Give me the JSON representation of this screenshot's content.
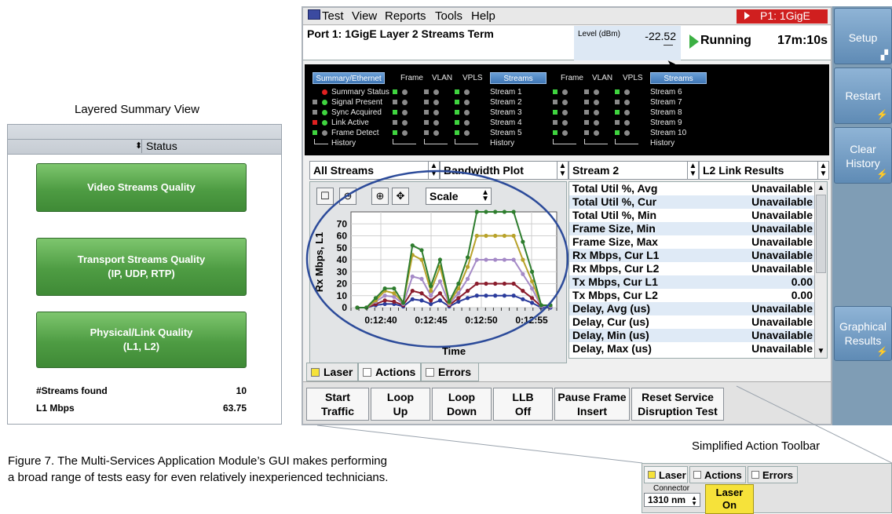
{
  "layered_summary": {
    "title": "Layered Summary View",
    "header_column": "Status",
    "buttons": [
      {
        "line1": "Video Streams Quality",
        "line2": ""
      },
      {
        "line1": "Transport Streams Quality",
        "line2": "(IP, UDP, RTP)"
      },
      {
        "line1": "Physical/Link Quality",
        "line2": "(L1, L2)"
      }
    ],
    "stats": [
      {
        "label": "#Streams found",
        "value": "10"
      },
      {
        "label": "L1 Mbps",
        "value": "63.75"
      }
    ],
    "colors": {
      "button_green": "#4e9c43"
    }
  },
  "menubar": {
    "items": [
      "Test",
      "View",
      "Reports",
      "Tools",
      "Help"
    ],
    "port_indicator": "P1: 1GigE",
    "indicator_color": "#d01f1f"
  },
  "status_bar": {
    "port_name": "Port 1: 1GigE Layer 2 Streams Term",
    "level_label": "Level (dBm)",
    "level_value": "-22.52",
    "state": "Running",
    "elapsed": "17m:10s"
  },
  "led_panel": {
    "summary_button": "Summary/Ethernet",
    "group1_headers": [
      "Frame",
      "VLAN",
      "VPLS"
    ],
    "group1_button": "Streams",
    "group2_headers": [
      "Frame",
      "VLAN",
      "VPLS"
    ],
    "group2_button": "Streams",
    "status_labels": [
      "Summary Status",
      "Signal Present",
      "Sync Acquired",
      "Link Active",
      "Frame Detect"
    ],
    "history_label": "History",
    "streams_a": [
      "Stream 1",
      "Stream 2",
      "Stream 3",
      "Stream 4",
      "Stream 5"
    ],
    "streams_b": [
      "Stream 6",
      "Stream 7",
      "Stream 8",
      "Stream 9",
      "Stream 10"
    ],
    "colors": {
      "green": "#3fd43f",
      "red": "#e02020",
      "grey": "#8a8a8a"
    }
  },
  "selectors": {
    "filter": "All Streams",
    "view": "Bandwidth Plot",
    "stream": "Stream 2",
    "results": "L2 Link Results"
  },
  "plot_toolbar": {
    "scale_label": "Scale"
  },
  "chart_data": {
    "type": "line",
    "title": "",
    "xlabel": "Time",
    "ylabel": "Rx Mbps, L1",
    "x_ticks": [
      "0:12:40",
      "0:12:45",
      "0:12:50",
      "0:12:55"
    ],
    "y_ticks": [
      0,
      10,
      20,
      30,
      40,
      50,
      60,
      70
    ],
    "ylim": [
      0,
      80
    ],
    "grid": true,
    "x": [
      0,
      1,
      2,
      3,
      4,
      5,
      6,
      7,
      8,
      9,
      10,
      11,
      12,
      13,
      14,
      15,
      16,
      17,
      18,
      19,
      20,
      21
    ],
    "series": [
      {
        "color": "#2e7d2e",
        "values": [
          0,
          0,
          8,
          16,
          16,
          4,
          52,
          48,
          18,
          40,
          5,
          20,
          42,
          80,
          80,
          80,
          80,
          80,
          55,
          30,
          2,
          2
        ]
      },
      {
        "color": "#b8a22a",
        "values": [
          0,
          0,
          6,
          14,
          12,
          4,
          44,
          40,
          14,
          34,
          4,
          16,
          34,
          60,
          60,
          60,
          60,
          60,
          40,
          22,
          2,
          2
        ]
      },
      {
        "color": "#a58ac7",
        "values": [
          0,
          0,
          5,
          10,
          9,
          3,
          26,
          24,
          10,
          22,
          3,
          12,
          24,
          40,
          40,
          40,
          40,
          40,
          28,
          16,
          1,
          1
        ]
      },
      {
        "color": "#8a1c2c",
        "values": [
          0,
          0,
          3,
          6,
          5,
          2,
          14,
          12,
          6,
          12,
          2,
          8,
          14,
          20,
          20,
          20,
          20,
          20,
          14,
          8,
          1,
          1
        ]
      },
      {
        "color": "#2a3b9c",
        "values": [
          0,
          0,
          2,
          3,
          3,
          1,
          7,
          6,
          3,
          6,
          1,
          5,
          8,
          10,
          10,
          10,
          10,
          10,
          7,
          4,
          0,
          0
        ]
      }
    ]
  },
  "results_table": [
    {
      "k": "Total Util %, Avg",
      "v": "Unavailable"
    },
    {
      "k": "Total Util %, Cur",
      "v": "Unavailable"
    },
    {
      "k": "Total Util %, Min",
      "v": "Unavailable"
    },
    {
      "k": "Frame Size, Min",
      "v": "Unavailable"
    },
    {
      "k": "Frame Size, Max",
      "v": "Unavailable"
    },
    {
      "k": "Rx Mbps, Cur L1",
      "v": "Unavailable"
    },
    {
      "k": "Rx Mbps, Cur L2",
      "v": "Unavailable"
    },
    {
      "k": "Tx Mbps, Cur L1",
      "v": "0.00"
    },
    {
      "k": "Tx Mbps, Cur L2",
      "v": "0.00"
    },
    {
      "k": "Delay, Avg (us)",
      "v": "Unavailable"
    },
    {
      "k": "Delay, Cur (us)",
      "v": "Unavailable"
    },
    {
      "k": "Delay, Min (us)",
      "v": "Unavailable"
    },
    {
      "k": "Delay, Max (us)",
      "v": "Unavailable"
    }
  ],
  "tabs": [
    "Laser",
    "Actions",
    "Errors"
  ],
  "actions": [
    {
      "line1": "Start",
      "line2": "Traffic"
    },
    {
      "line1": "Loop",
      "line2": "Up"
    },
    {
      "line1": "Loop",
      "line2": "Down"
    },
    {
      "line1": "LLB",
      "line2": "Off"
    },
    {
      "line1": "Pause Frame",
      "line2": "Insert"
    },
    {
      "line1": "Reset Service",
      "line2": "Disruption Test"
    }
  ],
  "softkeys": [
    {
      "line1": "Setup",
      "line2": ""
    },
    {
      "line1": "Restart",
      "line2": ""
    },
    {
      "line1": "Clear",
      "line2": "History"
    },
    {
      "line1": "Graphical",
      "line2": "Results"
    }
  ],
  "caption": {
    "line1": "Figure 7. The Multi-Services Application Module’s GUI makes performing",
    "line2": "a broad range of tests easy for even relatively inexperienced technicians."
  },
  "simplified_toolbar": {
    "title": "Simplified Action Toolbar",
    "tabs": [
      "Laser",
      "Actions",
      "Errors"
    ],
    "connector_label": "Connector",
    "connector_value": "1310 nm",
    "laser_button_line1": "Laser",
    "laser_button_line2": "On",
    "laser_color": "#f6e23a"
  }
}
